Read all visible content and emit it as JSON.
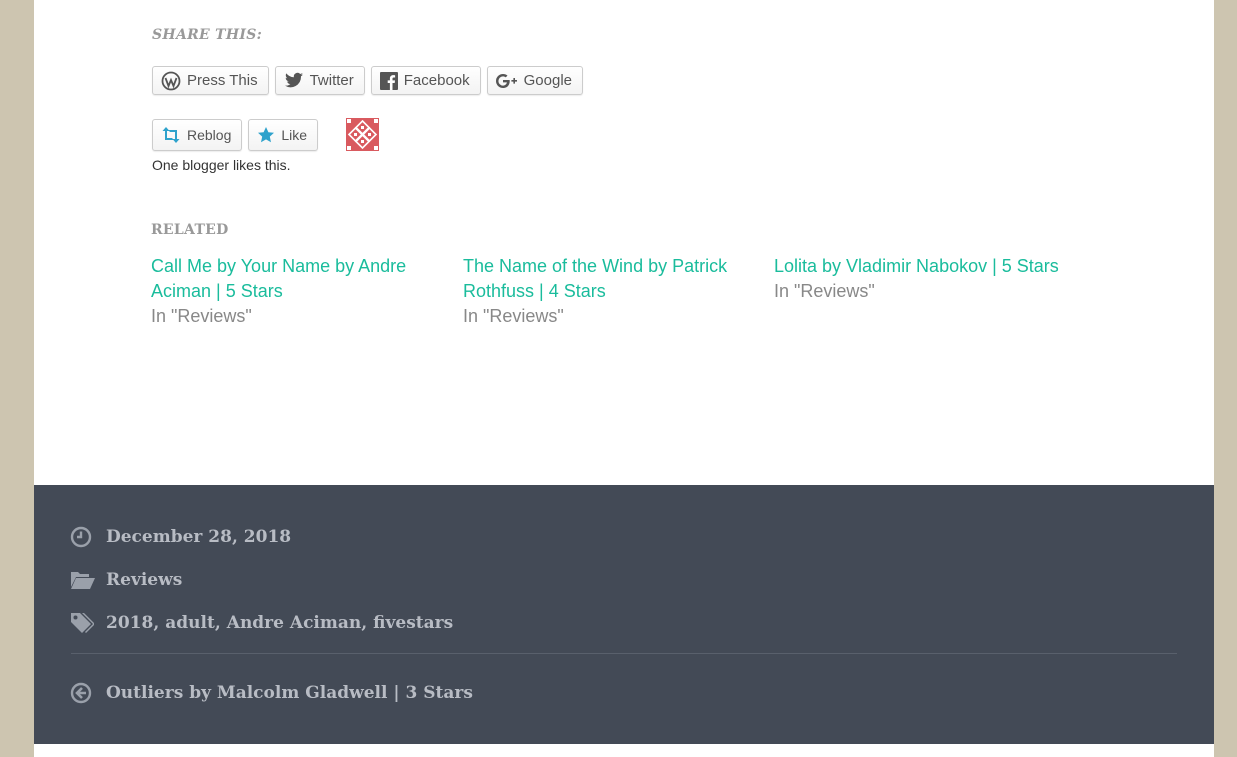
{
  "share": {
    "heading": "SHARE THIS:",
    "buttons": [
      {
        "label": "Press This",
        "icon": "wordpress-icon"
      },
      {
        "label": "Twitter",
        "icon": "twitter-icon"
      },
      {
        "label": "Facebook",
        "icon": "facebook-icon"
      },
      {
        "label": "Google",
        "icon": "google-plus-icon"
      }
    ]
  },
  "likes": {
    "reblog_label": "Reblog",
    "like_label": "Like",
    "summary": "One blogger likes this."
  },
  "related": {
    "heading": "RELATED",
    "items": [
      {
        "title": "Call Me by Your Name by Andre Aciman | 5 Stars",
        "context": "In \"Reviews\""
      },
      {
        "title": "The Name of the Wind by Patrick Rothfuss | 4 Stars",
        "context": "In \"Reviews\""
      },
      {
        "title": "Lolita by Vladimir Nabokov | 5 Stars",
        "context": "In \"Reviews\""
      }
    ]
  },
  "footer": {
    "date": "December 28, 2018",
    "category": "Reviews",
    "tags": [
      "2018",
      "adult",
      "Andre Aciman",
      "fivestars"
    ],
    "previous_post": "Outliers by Malcolm Gladwell | 3 Stars"
  },
  "colors": {
    "accent": "#1abc9c",
    "footer_bg": "#434a56",
    "outer_bg": "#cdc5b0",
    "avatar": "#d95a5f"
  }
}
